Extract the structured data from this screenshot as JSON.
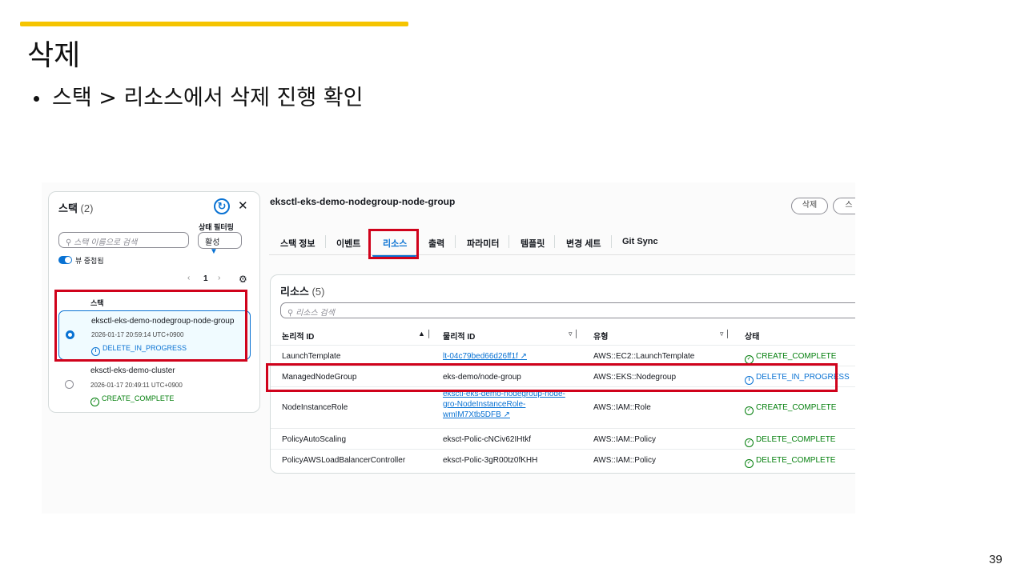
{
  "slide": {
    "title": "삭제",
    "bullet": "스택 > 리소스에서 삭제 진행 확인",
    "page_number": "39",
    "accent_color": "#f5c400"
  },
  "stacks_panel": {
    "title": "스택",
    "count": "(2)",
    "filter_label": "상태 필터링",
    "filter_value": "활성",
    "search_placeholder": "스택 이름으로 검색",
    "toggle_label": "뷰 중첩됨",
    "page": "1",
    "column_header": "스택",
    "items": [
      {
        "name": "eksctl-eks-demo-nodegroup-node-group",
        "time": "2026-01-17 20:59:14 UTC+0900",
        "status": "DELETE_IN_PROGRESS",
        "selected": true
      },
      {
        "name": "eksctl-eks-demo-cluster",
        "time": "2026-01-17 20:49:11 UTC+0900",
        "status": "CREATE_COMPLETE",
        "selected": false
      }
    ]
  },
  "detail": {
    "stack_name": "eksctl-eks-demo-nodegroup-node-group",
    "buttons": [
      "삭제",
      "스"
    ],
    "tabs": [
      "스택 정보",
      "이벤트",
      "리소스",
      "출력",
      "파라미터",
      "템플릿",
      "변경 세트",
      "Git Sync"
    ],
    "active_tab": "리소스",
    "resources": {
      "title": "리소스",
      "count": "(5)",
      "search_placeholder": "리소스 검색",
      "columns": [
        "논리적 ID",
        "물리적 ID",
        "유형",
        "상태"
      ],
      "rows": [
        {
          "logical": "LaunchTemplate",
          "physical": "lt-04c79bed66d26ff1f",
          "physical_link": true,
          "type": "AWS::EC2::LaunchTemplate",
          "status": "CREATE_COMPLETE"
        },
        {
          "logical": "ManagedNodeGroup",
          "physical": "eks-demo/node-group",
          "physical_link": false,
          "type": "AWS::EKS::Nodegroup",
          "status": "DELETE_IN_PROGRESS"
        },
        {
          "logical": "NodeInstanceRole",
          "physical": "eksctl-eks-demo-nodegroup-node-gro-NodeInstanceRole-wmIM7Xtb5DFB",
          "physical_lines": [
            "eksctl-eks-demo-nodegroup-node-",
            "gro-NodeInstanceRole-",
            "wmIM7Xtb5DFB"
          ],
          "physical_link": true,
          "type": "AWS::IAM::Role",
          "status": "CREATE_COMPLETE"
        },
        {
          "logical": "PolicyAutoScaling",
          "physical": "eksct-Polic-cNCiv62IHtkf",
          "physical_link": false,
          "type": "AWS::IAM::Policy",
          "status": "DELETE_COMPLETE"
        },
        {
          "logical": "PolicyAWSLoadBalancerController",
          "physical": "eksct-Polic-3gR00tz0fKHH",
          "physical_link": false,
          "type": "AWS::IAM::Policy",
          "status": "DELETE_COMPLETE"
        }
      ]
    }
  }
}
